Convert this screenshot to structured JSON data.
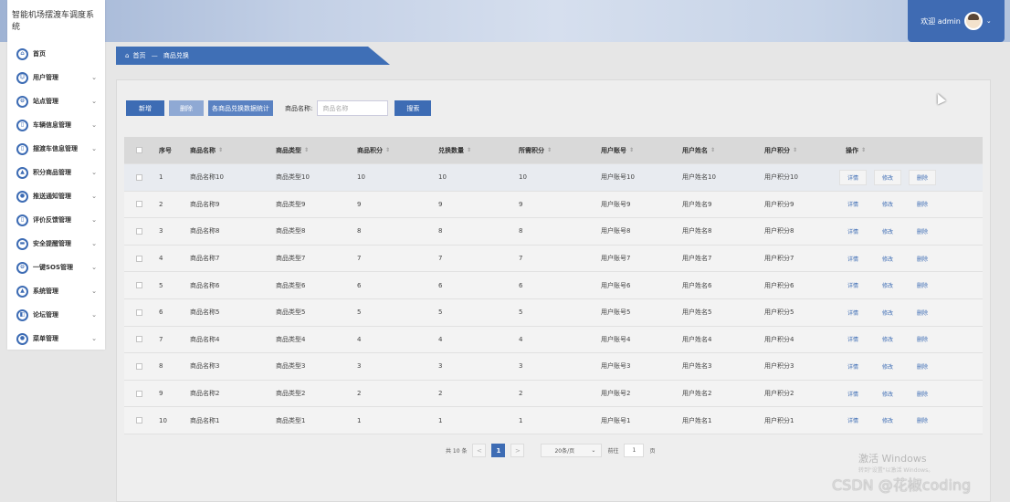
{
  "app": {
    "system_title": "智能机场摆渡车调度系统",
    "welcome_text": "欢迎 admin",
    "accent_color": "#3d6cb4"
  },
  "sidebar": {
    "items": [
      {
        "label": "首页",
        "icon": "home-icon",
        "glyph": "⌂",
        "has_children": false
      },
      {
        "label": "用户管理",
        "icon": "user-icon",
        "glyph": "☺",
        "has_children": true
      },
      {
        "label": "站点管理",
        "icon": "station-icon",
        "glyph": "⊖",
        "has_children": true
      },
      {
        "label": "车辆信息管理",
        "icon": "vehicle-icon",
        "glyph": "▯",
        "has_children": true
      },
      {
        "label": "摆渡车信息管理",
        "icon": "shuttle-icon",
        "glyph": "▯",
        "has_children": true
      },
      {
        "label": "积分商品管理",
        "icon": "goods-icon",
        "glyph": "▲",
        "has_children": true
      },
      {
        "label": "推送通知管理",
        "icon": "notify-icon",
        "glyph": "●",
        "has_children": true
      },
      {
        "label": "评价反馈管理",
        "icon": "feedback-icon",
        "glyph": "▯",
        "has_children": true
      },
      {
        "label": "安全提醒管理",
        "icon": "safety-icon",
        "glyph": "▬",
        "has_children": true
      },
      {
        "label": "一键SOS管理",
        "icon": "sos-icon",
        "glyph": "⊖",
        "has_children": true
      },
      {
        "label": "系统管理",
        "icon": "system-icon",
        "glyph": "▲",
        "has_children": true
      },
      {
        "label": "论坛管理",
        "icon": "forum-icon",
        "glyph": "◧",
        "has_children": true
      },
      {
        "label": "菜单管理",
        "icon": "menu-icon",
        "glyph": "●",
        "has_children": true
      }
    ]
  },
  "breadcrumb": {
    "home": "首页",
    "separator": "—",
    "current": "商品兑换"
  },
  "toolbar": {
    "add_label": "新增",
    "delete_label": "删除",
    "stat_label": "各商品兑换数据统计",
    "search_label": "商品名称:",
    "search_placeholder": "商品名称",
    "search_button": "搜索"
  },
  "table": {
    "columns": [
      "序号",
      "商品名称",
      "商品类型",
      "商品积分",
      "兑换数量",
      "所需积分",
      "用户账号",
      "用户姓名",
      "用户积分",
      "操作"
    ],
    "rows": [
      {
        "idx": "1",
        "name": "商品名称10",
        "type": "商品类型10",
        "points": "10",
        "qty": "10",
        "required": "10",
        "account": "用户账号10",
        "username": "用户姓名10",
        "user_points": "用户积分10"
      },
      {
        "idx": "2",
        "name": "商品名称9",
        "type": "商品类型9",
        "points": "9",
        "qty": "9",
        "required": "9",
        "account": "用户账号9",
        "username": "用户姓名9",
        "user_points": "用户积分9"
      },
      {
        "idx": "3",
        "name": "商品名称8",
        "type": "商品类型8",
        "points": "8",
        "qty": "8",
        "required": "8",
        "account": "用户账号8",
        "username": "用户姓名8",
        "user_points": "用户积分8"
      },
      {
        "idx": "4",
        "name": "商品名称7",
        "type": "商品类型7",
        "points": "7",
        "qty": "7",
        "required": "7",
        "account": "用户账号7",
        "username": "用户姓名7",
        "user_points": "用户积分7"
      },
      {
        "idx": "5",
        "name": "商品名称6",
        "type": "商品类型6",
        "points": "6",
        "qty": "6",
        "required": "6",
        "account": "用户账号6",
        "username": "用户姓名6",
        "user_points": "用户积分6"
      },
      {
        "idx": "6",
        "name": "商品名称5",
        "type": "商品类型5",
        "points": "5",
        "qty": "5",
        "required": "5",
        "account": "用户账号5",
        "username": "用户姓名5",
        "user_points": "用户积分5"
      },
      {
        "idx": "7",
        "name": "商品名称4",
        "type": "商品类型4",
        "points": "4",
        "qty": "4",
        "required": "4",
        "account": "用户账号4",
        "username": "用户姓名4",
        "user_points": "用户积分4"
      },
      {
        "idx": "8",
        "name": "商品名称3",
        "type": "商品类型3",
        "points": "3",
        "qty": "3",
        "required": "3",
        "account": "用户账号3",
        "username": "用户姓名3",
        "user_points": "用户积分3"
      },
      {
        "idx": "9",
        "name": "商品名称2",
        "type": "商品类型2",
        "points": "2",
        "qty": "2",
        "required": "2",
        "account": "用户账号2",
        "username": "用户姓名2",
        "user_points": "用户积分2"
      },
      {
        "idx": "10",
        "name": "商品名称1",
        "type": "商品类型1",
        "points": "1",
        "qty": "1",
        "required": "1",
        "account": "用户账号1",
        "username": "用户姓名1",
        "user_points": "用户积分1"
      }
    ],
    "actions": {
      "detail": "详情",
      "edit": "修改",
      "delete": "删除"
    }
  },
  "pagination": {
    "total": "共 10 条",
    "prev": "<",
    "current_page": "1",
    "next": ">",
    "page_size": "20条/页",
    "goto_label": "前往",
    "goto_value": "1",
    "page_unit": "页"
  },
  "watermark": {
    "activate_windows": "激活 Windows",
    "activate_hint": "转到\"设置\"以激活 Windows。",
    "csdn": "CSDN @花椒coding"
  }
}
